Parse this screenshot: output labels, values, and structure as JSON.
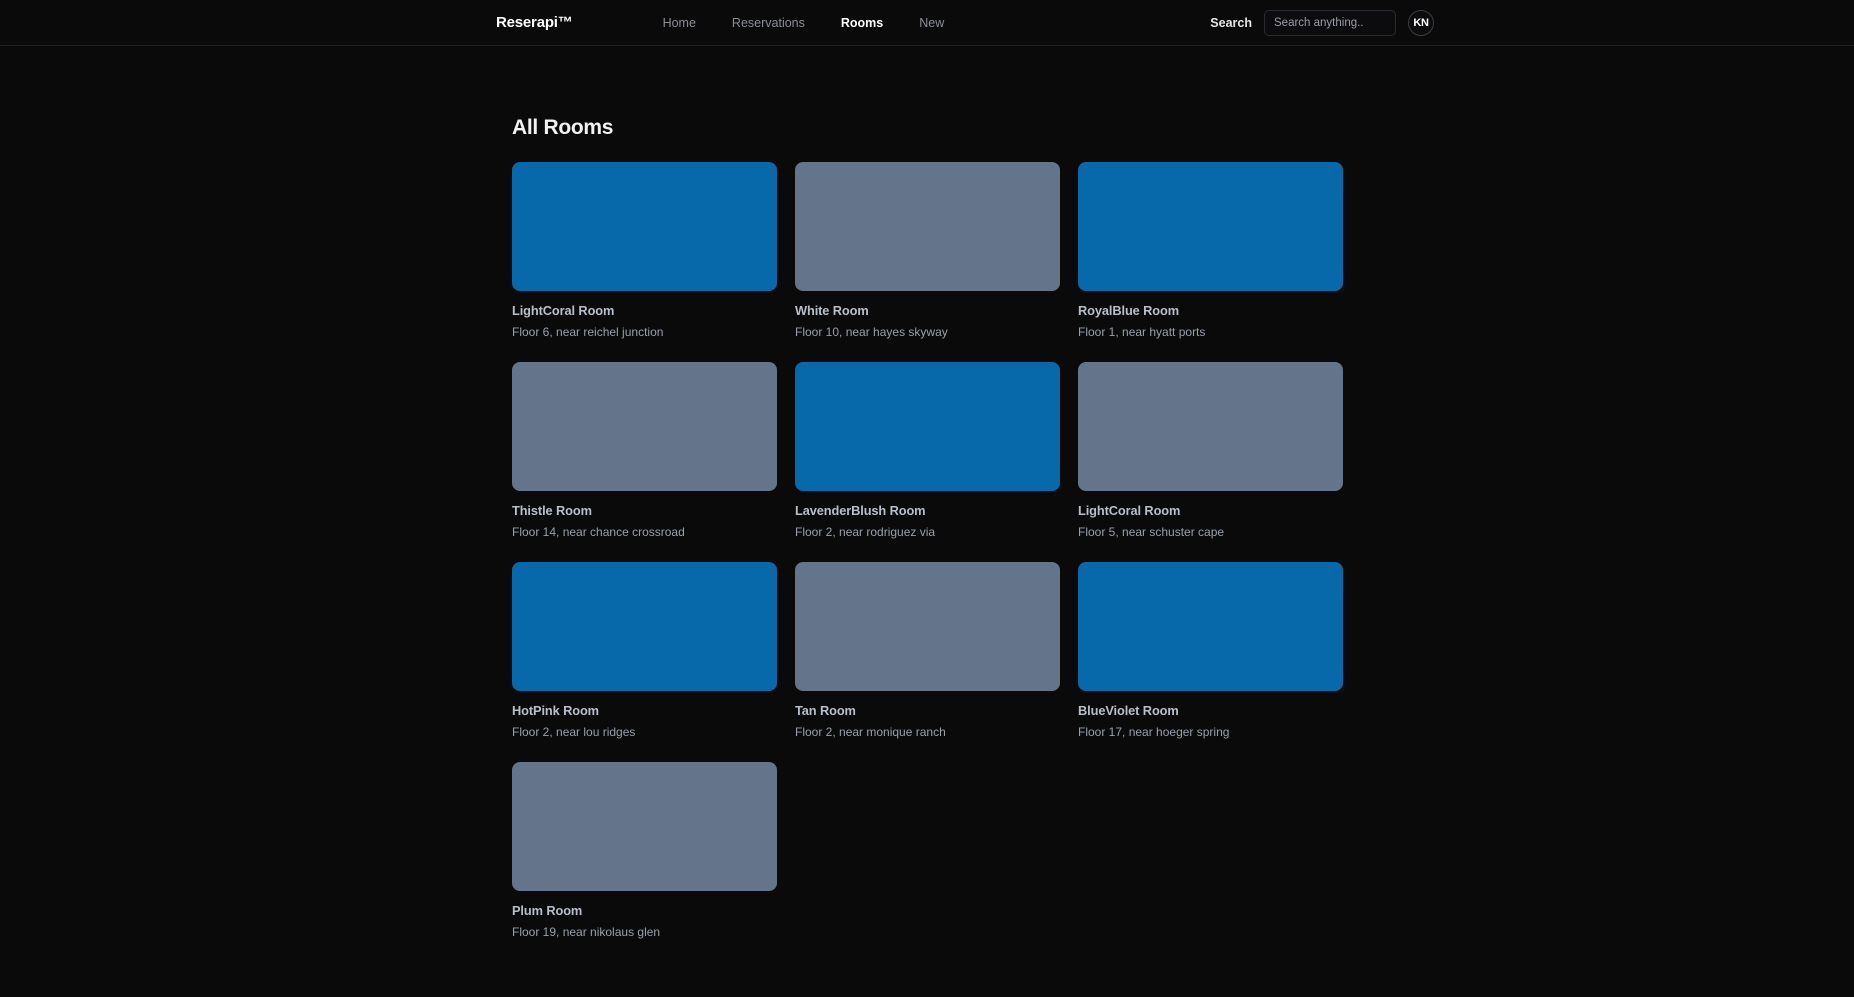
{
  "header": {
    "brand": "Reserapi™",
    "nav_items": [
      {
        "label": "Home",
        "active": false
      },
      {
        "label": "Reservations",
        "active": false
      },
      {
        "label": "Rooms",
        "active": true
      },
      {
        "label": "New",
        "active": false
      }
    ],
    "search_label": "Search",
    "search_value": "",
    "search_placeholder": "Search anything..",
    "avatar_initials": "KN"
  },
  "main": {
    "page_title": "All Rooms",
    "colors": {
      "blue": "#0769aa",
      "slate": "#64748b",
      "background": "#0a0a0b"
    },
    "rooms": [
      {
        "name": "LightCoral Room",
        "location": "Floor 6, near reichel junction",
        "swatch": "#0769aa"
      },
      {
        "name": "White Room",
        "location": "Floor 10, near hayes skyway",
        "swatch": "#64748b"
      },
      {
        "name": "RoyalBlue Room",
        "location": "Floor 1, near hyatt ports",
        "swatch": "#0769aa"
      },
      {
        "name": "Thistle Room",
        "location": "Floor 14, near chance crossroad",
        "swatch": "#64748b"
      },
      {
        "name": "LavenderBlush Room",
        "location": "Floor 2, near rodriguez via",
        "swatch": "#0769aa"
      },
      {
        "name": "LightCoral Room",
        "location": "Floor 5, near schuster cape",
        "swatch": "#64748b"
      },
      {
        "name": "HotPink Room",
        "location": "Floor 2, near lou ridges",
        "swatch": "#0769aa"
      },
      {
        "name": "Tan Room",
        "location": "Floor 2, near monique ranch",
        "swatch": "#64748b"
      },
      {
        "name": "BlueViolet Room",
        "location": "Floor 17, near hoeger spring",
        "swatch": "#0769aa"
      },
      {
        "name": "Plum Room",
        "location": "Floor 19, near nikolaus glen",
        "swatch": "#64748b"
      }
    ]
  }
}
